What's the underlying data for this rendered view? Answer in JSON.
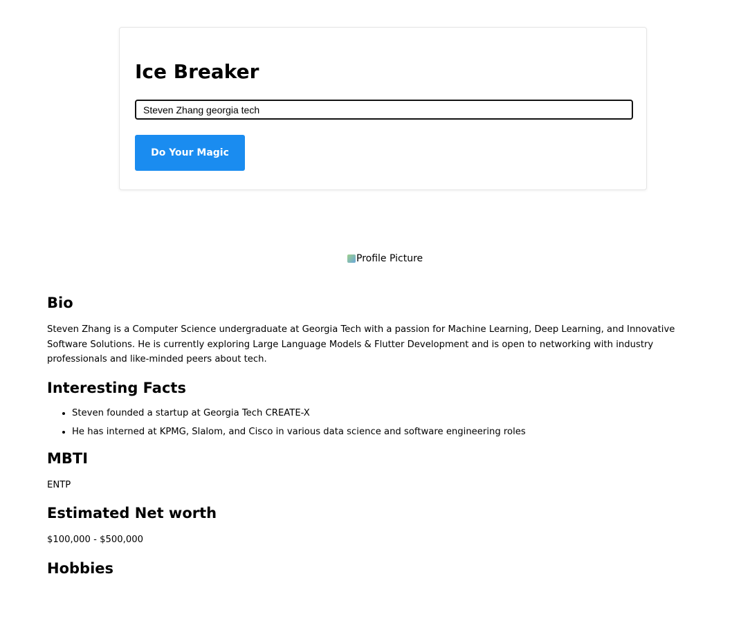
{
  "app": {
    "title": "Ice Breaker"
  },
  "search": {
    "value": "Steven Zhang georgia tech"
  },
  "actions": {
    "submit_label": "Do Your Magic"
  },
  "profile": {
    "picture_alt": "Profile Picture"
  },
  "bio": {
    "heading": "Bio",
    "text": "Steven Zhang is a Computer Science undergraduate at Georgia Tech with a passion for Machine Learning, Deep Learning, and Innovative Software Solutions. He is currently exploring Large Language Models & Flutter Development and is open to networking with industry professionals and like-minded peers about tech."
  },
  "facts": {
    "heading": "Interesting Facts",
    "items": [
      "Steven founded a startup at Georgia Tech CREATE-X",
      "He has interned at KPMG, Slalom, and Cisco in various data science and software engineering roles"
    ]
  },
  "mbti": {
    "heading": "MBTI",
    "value": "ENTP"
  },
  "net_worth": {
    "heading": "Estimated Net worth",
    "value": "$100,000 - $500,000"
  },
  "hobbies": {
    "heading": "Hobbies"
  },
  "colors": {
    "accent": "#1a8cf0",
    "card_border": "#e5e5e5"
  }
}
